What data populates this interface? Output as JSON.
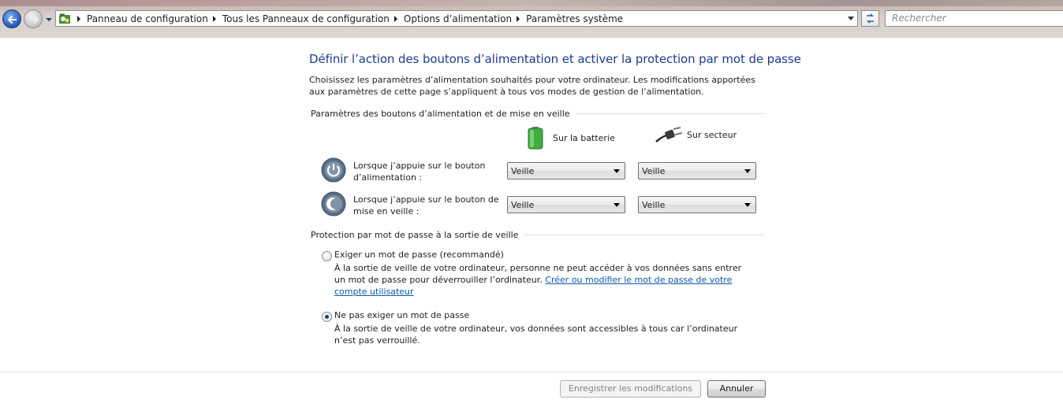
{
  "address_bar": {
    "breadcrumbs": [
      "Panneau de configuration",
      "Tous les Panneaux de configuration",
      "Options d’alimentation",
      "Paramètres système"
    ],
    "search_placeholder": "Rechercher"
  },
  "page": {
    "title": "Définir l’action des boutons d’alimentation et activer la protection par mot de passe",
    "description": "Choisissez les paramètres d’alimentation souhaités pour votre ordinateur. Les modifications apportées aux paramètres de cette page s’appliquent à tous vos modes de gestion de l’alimentation."
  },
  "buttons_section": {
    "header": "Paramètres des boutons d’alimentation et de mise en veille",
    "battery_label": "Sur la batterie",
    "ac_label": "Sur secteur",
    "rows": [
      {
        "label": "Lorsque j’appuie sur le bouton d’alimentation :",
        "battery_value": "Veille",
        "ac_value": "Veille"
      },
      {
        "label": "Lorsque j’appuie sur le bouton de mise en veille :",
        "battery_value": "Veille",
        "ac_value": "Veille"
      }
    ]
  },
  "password_section": {
    "header": "Protection par mot de passe à la sortie de veille",
    "option_require": {
      "label": "Exiger un mot de passe (recommandé)",
      "description": "À la sortie de veille de votre ordinateur, personne ne peut accéder à vos données sans entrer un mot de passe pour déverrouiller l’ordinateur.",
      "link": "Créer ou modifier le mot de passe de votre compte utilisateur",
      "selected": false
    },
    "option_none": {
      "label": "Ne pas exiger un mot de passe",
      "description": "À la sortie de veille de votre ordinateur, vos données sont accessibles à tous car l’ordinateur n’est pas verrouillé.",
      "selected": true
    }
  },
  "footer": {
    "save_label": "Enregistrer les modifications",
    "cancel_label": "Annuler"
  },
  "colors": {
    "title": "#1e3c8c",
    "link": "#0d58a6"
  }
}
